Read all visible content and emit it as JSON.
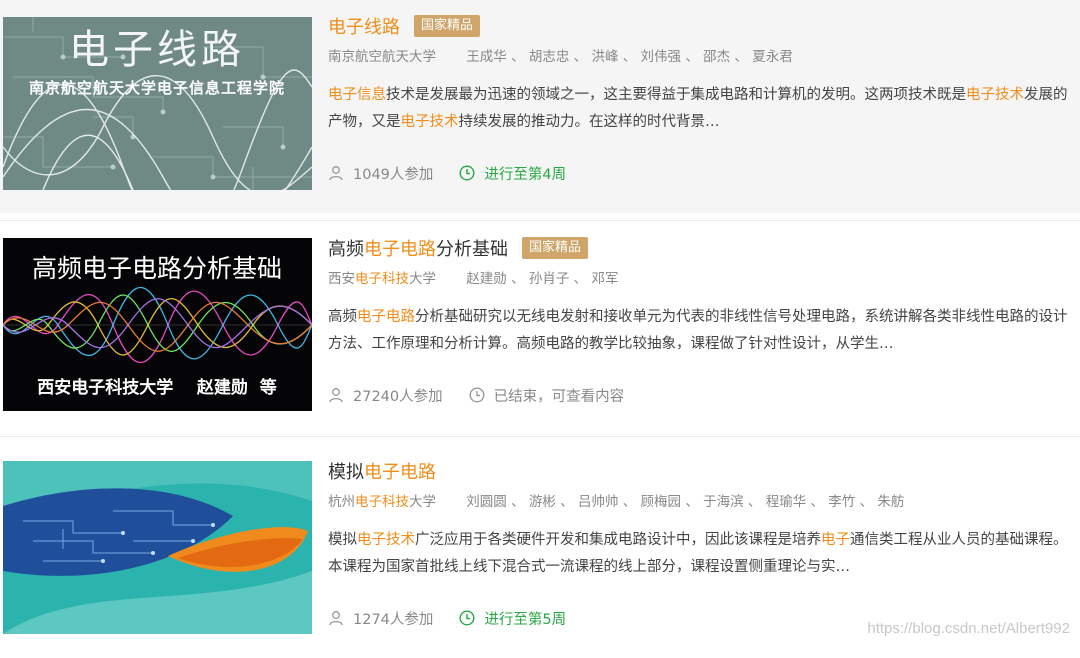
{
  "courses": [
    {
      "title_parts": [
        "电子线路"
      ],
      "badge": "国家精品",
      "school_parts": [
        "南京航空航天大学"
      ],
      "teachers": "王成华 、 胡志忠 、 洪峰 、 刘伟强 、 邵杰 、 夏永君",
      "desc_parts": [
        "电子信息",
        "技术是发展最为迅速的领域之一，这主要得益于集成电路和计算机的发明。这两项技术既是",
        "电子技术",
        "发展的产物，又是",
        "电子技术",
        "持续发展的推动力。在这样的时代背景…"
      ],
      "participants": "1049人参加",
      "status": "进行至第4周",
      "thumb_title": "电子线路",
      "thumb_subtitle": "南京航空航天大学电子信息工程学院"
    },
    {
      "title_parts": [
        "高频",
        "电子电路",
        "分析基础"
      ],
      "badge": "国家精品",
      "school_parts": [
        "西安",
        "电子科技",
        "大学"
      ],
      "teachers": "赵建勋 、 孙肖子 、 邓军",
      "desc_parts": [
        "高频",
        "电子电路",
        "分析基础研究以无线电发射和接收单元为代表的非线性信号处理电路，系统讲解各类非线性电路的设计方法、工作原理和分析计算。高频电路的教学比较抽象，课程做了针对性设计，从学生…"
      ],
      "participants": "27240人参加",
      "status": "已结束，可查看内容",
      "thumb_title": "高频电子电路分析基础",
      "thumb_subtitle": "西安电子科技大学    赵建勋  等"
    },
    {
      "title_parts": [
        "模拟",
        "电子电路"
      ],
      "badge": "",
      "school_parts": [
        "杭州",
        "电子科技",
        "大学"
      ],
      "teachers": "刘圆圆 、 游彬 、 吕帅帅 、 顾梅园 、 于海滨 、 程瑜华 、 李竹 、 朱舫",
      "desc_parts": [
        "模拟",
        "电子技术",
        "广泛应用于各类硬件开发和集成电路设计中，因此该课程是培养",
        "电子",
        "通信类工程从业人员的基础课程。本课程为国家首批线上线下混合式一流课程的线上部分，课程设置侧重理论与实…"
      ],
      "participants": "1274人参加",
      "status": "进行至第5周",
      "thumb_title": "",
      "thumb_subtitle": ""
    }
  ],
  "watermark": "https://blog.csdn.net/Albert992",
  "colors": {
    "highlight": "#f18e1a",
    "badge": "#cfa56a",
    "ongoing": "#27a745",
    "muted": "#888888"
  },
  "icons": {
    "participants": "user-icon",
    "status": "clock-icon"
  }
}
